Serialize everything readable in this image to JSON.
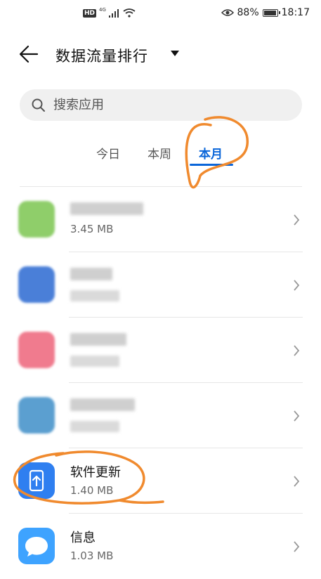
{
  "status_bar": {
    "hd": "HD",
    "network": "4G",
    "battery_pct": "88%",
    "time": "18:17"
  },
  "header": {
    "title": "数据流量排行"
  },
  "search": {
    "placeholder": "搜索应用"
  },
  "tabs": {
    "items": [
      {
        "label": "今日"
      },
      {
        "label": "本周"
      },
      {
        "label": "本月"
      }
    ],
    "selected_index": 2
  },
  "apps": [
    {
      "name": "",
      "size": "3.45 MB",
      "icon_color": "#8fce6a",
      "blurred_name": true,
      "blurred_size": false
    },
    {
      "name": "",
      "size": "",
      "icon_color": "#4a7fd8",
      "blurred_name": true,
      "blurred_size": true
    },
    {
      "name": "",
      "size": "",
      "icon_color": "#f07b8e",
      "blurred_name": true,
      "blurred_size": true
    },
    {
      "name": "",
      "size": "",
      "icon_color": "#5b9fd0",
      "blurred_name": true,
      "blurred_size": true
    },
    {
      "name": "软件更新",
      "size": "1.40 MB",
      "icon_color": "#2f7ff0",
      "icon": "software-update-icon"
    },
    {
      "name": "信息",
      "size": "1.03 MB",
      "icon_color": "#3ea3ff",
      "icon": "message-bubble-icon"
    }
  ],
  "colors": {
    "accent": "#0a66d9",
    "annotation": "#f08a2e"
  }
}
